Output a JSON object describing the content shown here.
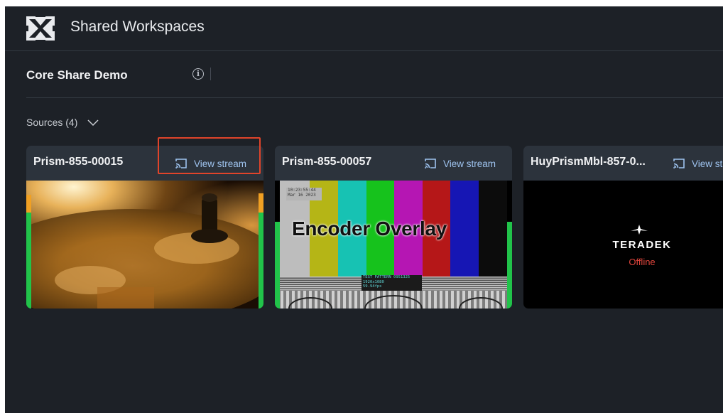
{
  "app": {
    "title": "Shared Workspaces",
    "logo_icon": "teradek-share-logo"
  },
  "workspace": {
    "name": "Core Share Demo",
    "info_icon": "info-icon"
  },
  "sources": {
    "label": "Sources (4)",
    "expanded": true
  },
  "cards": [
    {
      "name": "Prism-855-00015",
      "action": "View stream",
      "status": "live",
      "preview": "cymbal-video"
    },
    {
      "name": "Prism-855-00057",
      "action": "View stream",
      "status": "live",
      "preview": "test-pattern",
      "overlay_text": "Encoder Overlay",
      "pattern_info": [
        "10:23:55:44",
        "Mar 16 2023"
      ],
      "pattern_caption": [
        "TEST PATTERN 0951325",
        "1920x1080",
        "59.94fps"
      ]
    },
    {
      "name": "HuyPrismMbl-857-0...",
      "action": "View stream",
      "status": "Offline",
      "brand": "TERADEK"
    }
  ],
  "colors": {
    "background": "#1d2127",
    "card": "#2c333c",
    "accent": "#9fc4f0",
    "offline": "#e0453c",
    "highlight": "#e0442a",
    "meter_green": "#21c34a",
    "meter_orange": "#f0a023"
  }
}
